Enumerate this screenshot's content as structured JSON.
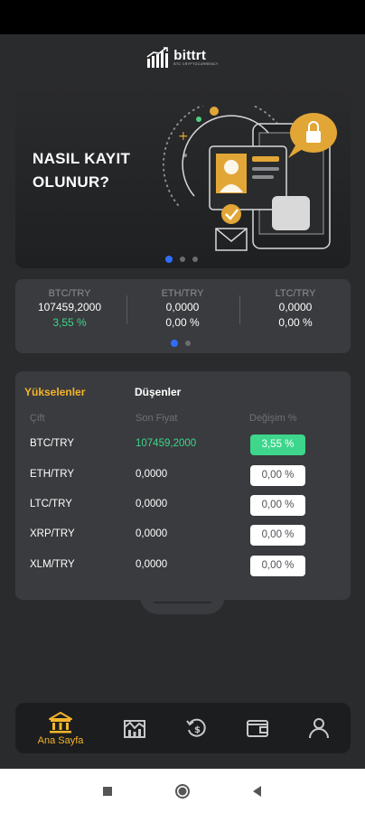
{
  "app": {
    "logo_text": "bittrt",
    "logo_subtext": "BTC CRYPTOCURRENCY"
  },
  "banner": {
    "title": "NASIL KAYIT OLUNUR?",
    "slide_count": 3,
    "active_slide": 1
  },
  "tickers": [
    {
      "pair": "BTC/TRY",
      "price": "107459,2000",
      "change": "3,55 %",
      "direction": "up"
    },
    {
      "pair": "ETH/TRY",
      "price": "0,0000",
      "change": "0,00 %",
      "direction": "flat"
    },
    {
      "pair": "LTC/TRY",
      "price": "0,0000",
      "change": "0,00 %",
      "direction": "flat"
    }
  ],
  "ticker_pages": {
    "count": 2,
    "active": 1
  },
  "market": {
    "tabs": [
      "Yükselenler",
      "Düşenler"
    ],
    "active_tab": "Yükselenler",
    "columns": [
      "Çift",
      "Son Fiyat",
      "Değişim %"
    ],
    "rows": [
      {
        "pair": "BTC/TRY",
        "price": "107459,2000",
        "change": "3,55 %",
        "direction": "up"
      },
      {
        "pair": "ETH/TRY",
        "price": "0,0000",
        "change": "0,00 %",
        "direction": "flat"
      },
      {
        "pair": "LTC/TRY",
        "price": "0,0000",
        "change": "0,00 %",
        "direction": "flat"
      },
      {
        "pair": "XRP/TRY",
        "price": "0,0000",
        "change": "0,00 %",
        "direction": "flat"
      },
      {
        "pair": "XLM/TRY",
        "price": "0,0000",
        "change": "0,00 %",
        "direction": "flat"
      }
    ]
  },
  "bottom_nav": {
    "items": [
      {
        "icon": "bank-icon",
        "label": "Ana Sayfa",
        "active": true
      },
      {
        "icon": "market-chart-icon",
        "label": "",
        "active": false
      },
      {
        "icon": "history-icon",
        "label": "",
        "active": false
      },
      {
        "icon": "wallet-icon",
        "label": "",
        "active": false
      },
      {
        "icon": "user-icon",
        "label": "",
        "active": false
      }
    ]
  },
  "colors": {
    "background": "#2a2b2d",
    "card": "#3a3b3e",
    "accent": "#f5b529",
    "positive": "#3dd68c",
    "indicator": "#2f6dff"
  }
}
